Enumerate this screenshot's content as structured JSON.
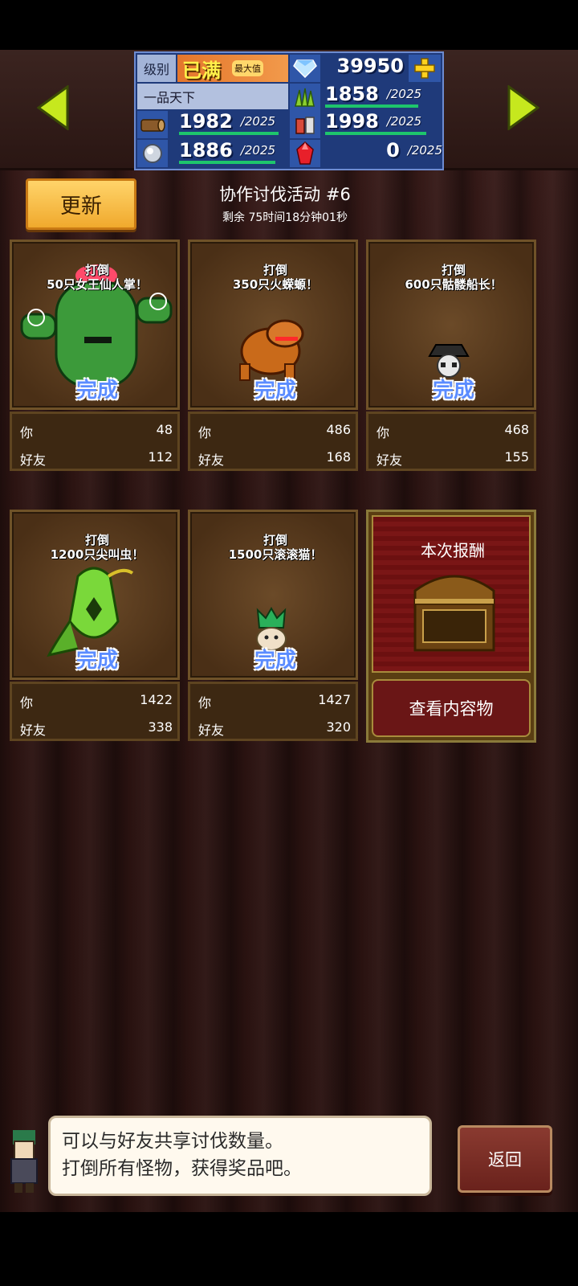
{
  "header": {
    "level_label": "级别",
    "level_value": "已满",
    "level_badge": "最大值",
    "rank_name": "一品天下",
    "gems": "39950",
    "resources": [
      {
        "name": "wood-icon",
        "value": "1982",
        "cap": "/2025",
        "fill": 0.98
      },
      {
        "name": "grass-icon",
        "value": "1858",
        "cap": "/2025",
        "fill": 0.92
      },
      {
        "name": "food-icon",
        "value": "1998",
        "cap": "/2025",
        "fill": 0.99
      },
      {
        "name": "ore-icon",
        "value": "1886",
        "cap": "/2025",
        "fill": 0.93
      },
      {
        "name": "ruby-icon",
        "value": "0",
        "cap": "/2025",
        "fill": 0.0
      }
    ]
  },
  "event": {
    "update_label": "更新",
    "title": "协作讨伐活动 #6",
    "remaining": "剩余 75时间18分钟01秒"
  },
  "cards": [
    {
      "target_line1": "打倒",
      "target_line2": "50只女王仙人掌！",
      "status": "完成",
      "you_label": "你",
      "you": "48",
      "friend_label": "好友",
      "friend": "112"
    },
    {
      "target_line1": "打倒",
      "target_line2": "350只火蝾螈！",
      "status": "完成",
      "you_label": "你",
      "you": "486",
      "friend_label": "好友",
      "friend": "168"
    },
    {
      "target_line1": "打倒",
      "target_line2": "600只骷髅船长！",
      "status": "完成",
      "you_label": "你",
      "you": "468",
      "friend_label": "好友",
      "friend": "155"
    },
    {
      "target_line1": "打倒",
      "target_line2": "1200只尖叫虫！",
      "status": "完成",
      "you_label": "你",
      "you": "1422",
      "friend_label": "好友",
      "friend": "338"
    },
    {
      "target_line1": "打倒",
      "target_line2": "1500只滚滚猫！",
      "status": "完成",
      "you_label": "你",
      "you": "1427",
      "friend_label": "好友",
      "friend": "320"
    }
  ],
  "reward": {
    "title": "本次报酬",
    "view_label": "查看内容物"
  },
  "dialog": {
    "line1": "可以与好友共享讨伐数量。",
    "line2": "打倒所有怪物，获得奖品吧。"
  },
  "back_label": "返回"
}
